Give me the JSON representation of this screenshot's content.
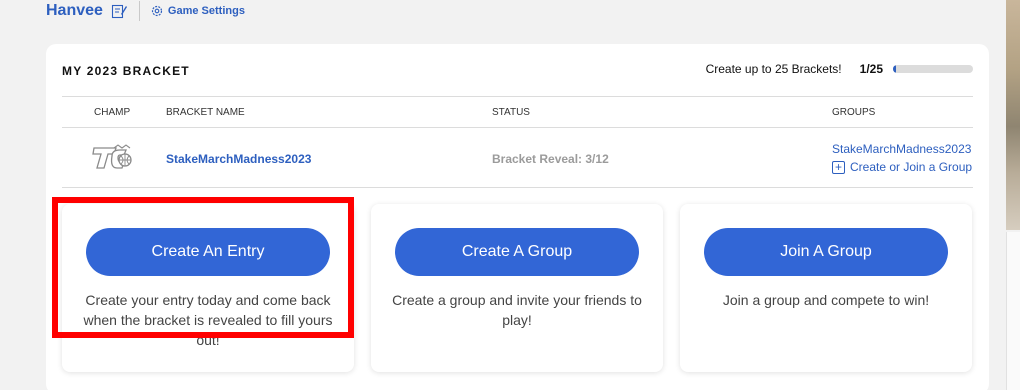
{
  "header": {
    "user_name": "Hanvee",
    "edit_icon": "edit-icon",
    "settings_icon": "gear-icon",
    "settings_label": "Game Settings"
  },
  "bracket": {
    "title": "MY 2023 BRACKET",
    "quota_text": "Create up to 25 Brackets!",
    "quota_count": "1/25",
    "quota_fraction": 0.04,
    "columns": {
      "champ": "CHAMP",
      "name": "BRACKET NAME",
      "status": "STATUS",
      "groups": "GROUPS"
    },
    "rows": [
      {
        "name": "StakeMarchMadness2023",
        "status": "Bracket Reveal: 3/12",
        "group": "StakeMarchMadness2023",
        "join_label": "Create or Join a Group"
      }
    ]
  },
  "actions": [
    {
      "button": "Create An Entry",
      "desc": "Create your entry today and come back when the bracket is revealed to fill yours out!"
    },
    {
      "button": "Create A Group",
      "desc": "Create a group and invite your friends to play!"
    },
    {
      "button": "Join A Group",
      "desc": "Join a group and compete to win!"
    }
  ],
  "colors": {
    "accent": "#3266d6",
    "link": "#2d5fbf",
    "highlight": "#ff0000"
  }
}
